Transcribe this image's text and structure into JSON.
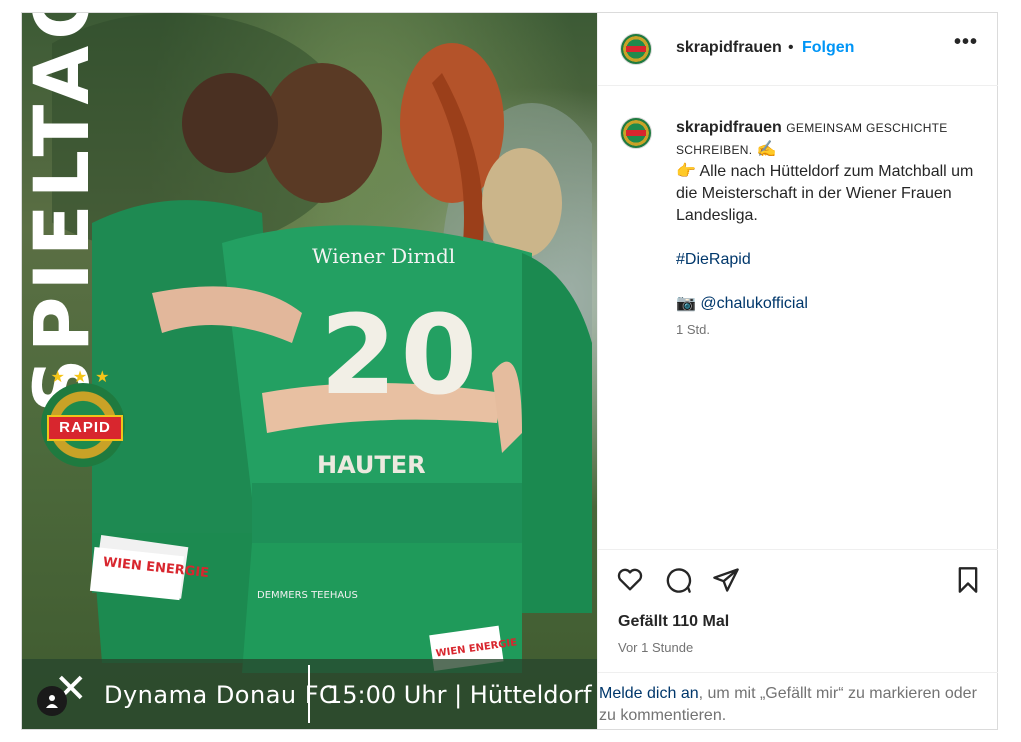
{
  "post": {
    "media": {
      "vertical_title": "SPIELTAG",
      "match": "Dynama Donau FC",
      "time_location": "15:00 Uhr | Hütteldorf",
      "club_badge_text": "RAPID",
      "jersey_number": "20",
      "jersey_name": "HAUTER",
      "sponsor_chest": "Wiener Dirndl",
      "sponsor_shorts": "WIEN ENERGIE",
      "sponsor_shorts_2": "DEMMERS TEEHAUS",
      "sponsor_shorts_3": "WIEN ENERGIE"
    },
    "header": {
      "username": "skrapidfrauen",
      "separator": "•",
      "follow_label": "Folgen",
      "more_label": "•••"
    },
    "caption": {
      "username": "skrapidfrauen",
      "headline": "GEMEINSAM GESCHICHTE SCHREIBEN.",
      "headline_emoji": "✍",
      "line1_emoji": "👉",
      "line1": "Alle nach Hütteldorf zum Matchball um die Meisterschaft in der Wiener Frauen Landesliga.",
      "hashtag": "#DieRapid",
      "camera_emoji": "📷",
      "mention": "@chalukofficial",
      "time_ago": "1 Std."
    },
    "likes_text": "Gefällt 110 Mal",
    "posted_ago": "Vor 1 Stunde",
    "login_link": "Melde dich an",
    "login_rest": ", um mit „Gefällt mir“ zu markieren oder zu kommentieren.",
    "colors": {
      "follow": "#0095f6",
      "link": "#00376b",
      "muted": "#737373",
      "jersey_green": "#1f9a5a"
    },
    "icons": [
      "heart-icon",
      "comment-icon",
      "share-icon",
      "bookmark-icon",
      "more-icon",
      "user-tag-icon"
    ]
  }
}
